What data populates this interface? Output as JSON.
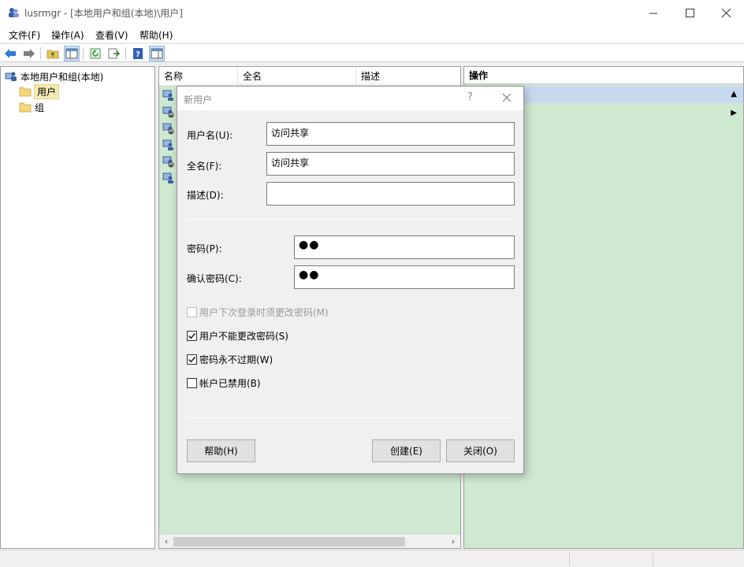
{
  "window": {
    "app": "lusrmgr",
    "title_suffix": " - [本地用户和组(本地)\\用户]"
  },
  "menu": {
    "items": [
      "文件(F)",
      "操作(A)",
      "查看(V)",
      "帮助(H)"
    ]
  },
  "tree": {
    "root": "本地用户和组(本地)",
    "children": [
      "用户",
      "组"
    ],
    "selected": "用户"
  },
  "list": {
    "columns": [
      "名称",
      "全名",
      "描述"
    ],
    "row_count_visible": 6
  },
  "actions": {
    "title": "操作"
  },
  "dialog": {
    "title": "新用户",
    "help_glyph": "?",
    "username_label": "用户名(U):",
    "username_value": "访问共享",
    "fullname_label": "全名(F):",
    "fullname_value": "访问共享",
    "description_label": "描述(D):",
    "description_value": "",
    "password_label": "密码(P):",
    "password_value": "●●",
    "confirm_label": "确认密码(C):",
    "confirm_value": "●●",
    "checkboxes": [
      {
        "label": "用户下次登录时须更改密码(M)",
        "checked": false,
        "enabled": false
      },
      {
        "label": "用户不能更改密码(S)",
        "checked": true,
        "enabled": true
      },
      {
        "label": "密码永不过期(W)",
        "checked": true,
        "enabled": true
      },
      {
        "label": "帐户已禁用(B)",
        "checked": false,
        "enabled": true
      }
    ],
    "help_button": "帮助(H)",
    "create_button": "创建(E)",
    "close_button": "关闭(O)"
  }
}
